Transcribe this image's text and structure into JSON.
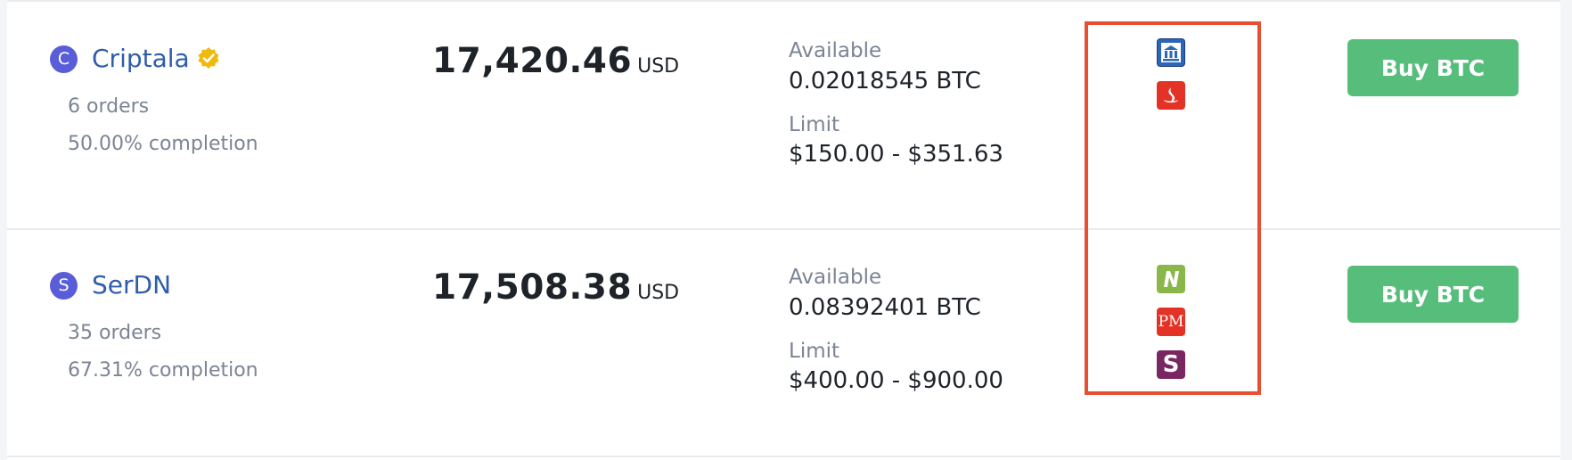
{
  "listings": [
    {
      "avatar_letter": "C",
      "name": "Criptala",
      "verified": true,
      "orders": "6 orders",
      "completion": "50.00% completion",
      "price": "17,420.46",
      "currency": "USD",
      "available_label": "Available",
      "available_value": "0.02018545 BTC",
      "limit_label": "Limit",
      "limit_value": "$150.00 - $351.63",
      "payment_icons": [
        "bank-transfer-icon",
        "santander-icon"
      ],
      "button_label": "Buy BTC"
    },
    {
      "avatar_letter": "S",
      "name": "SerDN",
      "verified": false,
      "orders": "35 orders",
      "completion": "67.31% completion",
      "price": "17,508.38",
      "currency": "USD",
      "available_label": "Available",
      "available_value": "0.08392401 BTC",
      "limit_label": "Limit",
      "limit_value": "$400.00 - $900.00",
      "payment_icons": [
        "neteller-icon",
        "perfect-money-icon",
        "skrill-icon"
      ],
      "button_label": "Buy BTC",
      "payment_icon_text": {
        "perfect_money": "PM"
      }
    }
  ],
  "colors": {
    "accent_green": "#56be7a",
    "name_blue": "#2f5dab",
    "avatar": "#5a5dd8",
    "verified_badge": "#f0b90b",
    "highlight_red": "#e84e32"
  }
}
